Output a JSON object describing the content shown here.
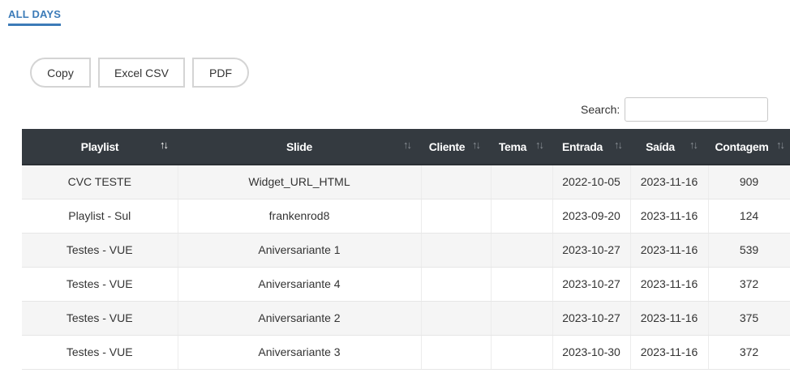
{
  "tab": {
    "label": "ALL DAYS"
  },
  "buttons": {
    "copy": "Copy",
    "csv": "Excel CSV",
    "pdf": "PDF"
  },
  "search": {
    "label": "Search:",
    "value": ""
  },
  "table": {
    "columns": [
      "Playlist",
      "Slide",
      "Cliente",
      "Tema",
      "Entrada",
      "Saída",
      "Contagem"
    ],
    "sort_icon": "↑↓",
    "rows": [
      [
        "CVC TESTE",
        "Widget_URL_HTML",
        "",
        "",
        "2022-10-05",
        "2023-11-16",
        "909"
      ],
      [
        "Playlist - Sul",
        "frankenrod8",
        "",
        "",
        "2023-09-20",
        "2023-11-16",
        "124"
      ],
      [
        "Testes - VUE",
        "Aniversariante 1",
        "",
        "",
        "2023-10-27",
        "2023-11-16",
        "539"
      ],
      [
        "Testes - VUE",
        "Aniversariante 4",
        "",
        "",
        "2023-10-27",
        "2023-11-16",
        "372"
      ],
      [
        "Testes - VUE",
        "Aniversariante 2",
        "",
        "",
        "2023-10-27",
        "2023-11-16",
        "375"
      ],
      [
        "Testes - VUE",
        "Aniversariante 3",
        "",
        "",
        "2023-10-30",
        "2023-11-16",
        "372"
      ]
    ]
  },
  "colors": {
    "accent": "#3c7bb8",
    "header_bg": "#343a40",
    "stripe": "#f5f5f5"
  }
}
